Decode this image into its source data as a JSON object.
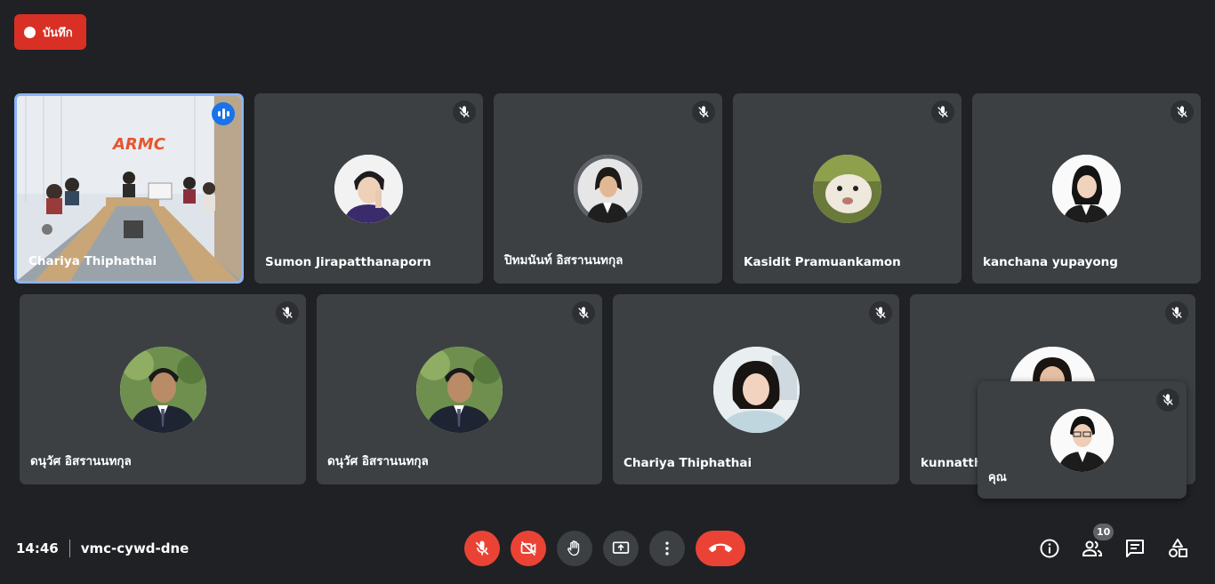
{
  "record_button": {
    "label": "บันทึก"
  },
  "meeting": {
    "time": "14:46",
    "code": "vmc-cywd-dne"
  },
  "participants": [
    {
      "name": "Chariya Thiphathai",
      "video": true,
      "speaking": true
    },
    {
      "name": "Sumon Jirapatthanaporn",
      "muted": true
    },
    {
      "name": "ปิทมนันท์ อิสรานนทกุล",
      "muted": true
    },
    {
      "name": "Kasidit Pramuankamon",
      "muted": true
    },
    {
      "name": "kanchana yupayong",
      "muted": true
    },
    {
      "name": "ดนุวัศ อิสรานนทกุล",
      "muted": true
    },
    {
      "name": "ดนุวัศ อิสรานนทกุล",
      "muted": true
    },
    {
      "name": "Chariya Thiphathai",
      "muted": true
    },
    {
      "name": "kunnattha",
      "muted": true
    }
  ],
  "self_view": {
    "name": "คุณ",
    "muted": true
  },
  "participant_count": "10",
  "video_sign_text": "ARMC",
  "colors": {
    "background": "#202124",
    "tile": "#3c4043",
    "danger": "#ea4335",
    "active_border": "#8ab4f8",
    "speaking": "#1a73e8"
  },
  "controls": [
    "mic-off-icon",
    "camera-off-icon",
    "raise-hand-icon",
    "present-screen-icon",
    "more-options-icon",
    "end-call-icon"
  ],
  "right_controls": [
    "info-icon",
    "people-icon",
    "chat-icon",
    "activities-icon"
  ]
}
